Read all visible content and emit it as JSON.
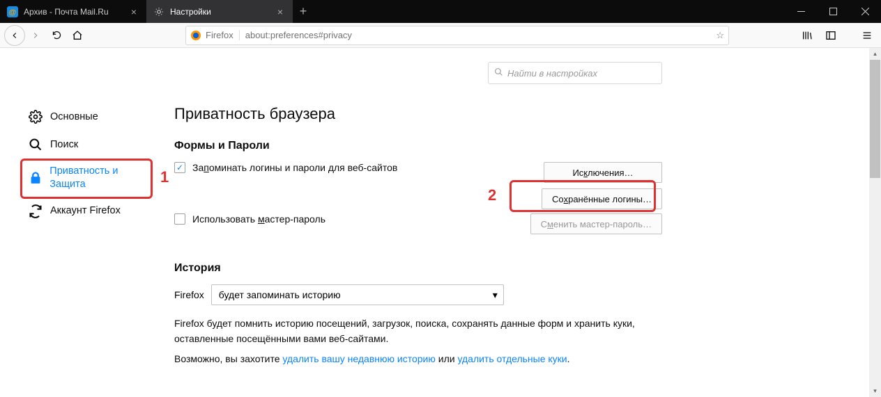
{
  "tabs": [
    {
      "title": "Архив - Почта Mail.Ru",
      "active": false
    },
    {
      "title": "Настройки",
      "active": true
    }
  ],
  "urlbar": {
    "brand": "Firefox",
    "address": "about:preferences#privacy"
  },
  "search": {
    "placeholder": "Найти в настройках"
  },
  "sidebar": {
    "items": [
      {
        "id": "general",
        "label": "Основные"
      },
      {
        "id": "search",
        "label": "Поиск"
      },
      {
        "id": "privacy",
        "label": "Приватность и Защита",
        "selected": true
      },
      {
        "id": "sync",
        "label": "Аккаунт Firefox"
      }
    ]
  },
  "page": {
    "title": "Приватность браузера",
    "forms_section": "Формы и Пароли",
    "remember_pre": "За",
    "remember_u": "п",
    "remember_post": "оминать логины и пароли для веб-сайтов",
    "exceptions_pre": "Ис",
    "exceptions_u": "к",
    "exceptions_post": "лючения…",
    "saved_pre": "Со",
    "saved_u": "х",
    "saved_post": "ранённые логины…",
    "master_pre": "Использовать ",
    "master_u": "м",
    "master_post": "астер-пароль",
    "change_pre": "С",
    "change_u": "м",
    "change_post": "енить мастер-пароль…",
    "history_section": "История",
    "history_label": "Firefox",
    "history_select": "будет запоминать историю",
    "desc1": "Firefox будет помнить историю посещений, загрузок, поиска, сохранять данные форм и хранить куки, оставленные посещёнными вами веб-сайтами.",
    "desc2_pre": "Возможно, вы захотите ",
    "desc2_link1": "удалить вашу недавнюю историю",
    "desc2_mid": " или ",
    "desc2_link2": "удалить отдельные куки",
    "desc2_post": "."
  },
  "annotations": {
    "num1": "1",
    "num2": "2"
  }
}
